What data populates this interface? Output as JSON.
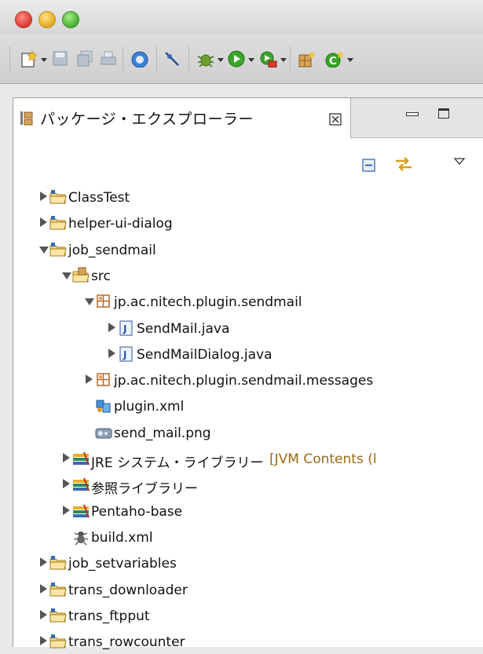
{
  "view": {
    "tab_label": "パッケージ・エクスプローラー",
    "tab_close_glyph": "⊠"
  },
  "tree": [
    {
      "label": "ClassTest",
      "icon": "project-folder-icon"
    },
    {
      "label": "helper-ui-dialog",
      "icon": "project-folder-icon"
    },
    {
      "label": "job_sendmail",
      "icon": "project-folder-icon"
    },
    {
      "label": "src",
      "icon": "source-folder-icon"
    },
    {
      "label": "jp.ac.nitech.plugin.sendmail",
      "icon": "package-icon"
    },
    {
      "label": "SendMail.java",
      "icon": "java-file-icon"
    },
    {
      "label": "SendMailDialog.java",
      "icon": "java-file-icon"
    },
    {
      "label": "jp.ac.nitech.plugin.sendmail.messages",
      "icon": "package-icon"
    },
    {
      "label": "plugin.xml",
      "icon": "plugin-xml-icon"
    },
    {
      "label": "send_mail.png",
      "icon": "image-file-icon"
    },
    {
      "label": "JRE システム・ライブラリー",
      "decoration": "[JVM Contents (l",
      "icon": "library-icon"
    },
    {
      "label": "参照ライブラリー",
      "icon": "library-icon"
    },
    {
      "label": "Pentaho-base",
      "icon": "library-icon"
    },
    {
      "label": "build.xml",
      "icon": "ant-file-icon"
    },
    {
      "label": "job_setvariables",
      "icon": "project-folder-icon"
    },
    {
      "label": "trans_downloader",
      "icon": "project-folder-icon"
    },
    {
      "label": "trans_ftpput",
      "icon": "project-folder-icon"
    },
    {
      "label": "trans_rowcounter",
      "icon": "project-folder-icon"
    }
  ]
}
